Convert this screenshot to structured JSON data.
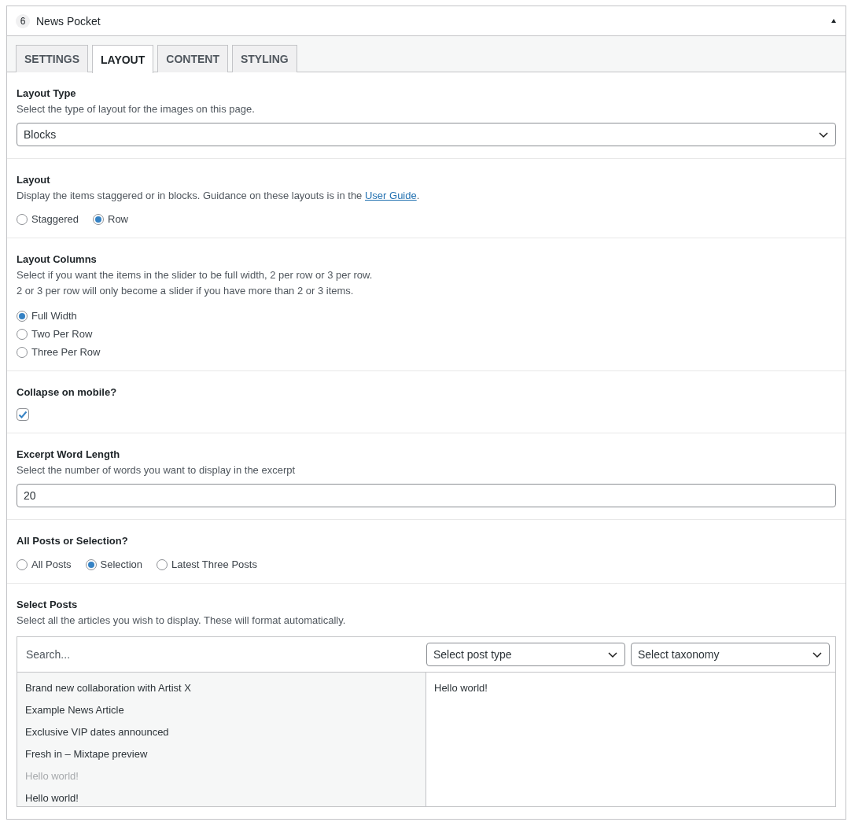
{
  "widget": {
    "number": "6",
    "title": "News Pocket",
    "expanded": true
  },
  "tabs": [
    {
      "label": "SETTINGS",
      "selected": false
    },
    {
      "label": "LAYOUT",
      "selected": true
    },
    {
      "label": "CONTENT",
      "selected": false
    },
    {
      "label": "STYLING",
      "selected": false
    }
  ],
  "fields": [
    {
      "kind": "select",
      "label": "Layout Type",
      "description": [
        "Select the type of layout for the images on this page."
      ],
      "value": "Blocks"
    },
    {
      "kind": "radio-row",
      "label": "Layout",
      "description": [
        "Display the items staggered or in blocks. Guidance on these layouts is in the "
      ],
      "link": "User Guide",
      "description_end": ".",
      "options": [
        {
          "label": "Staggered",
          "selected": false
        },
        {
          "label": "Row",
          "selected": true
        }
      ]
    },
    {
      "kind": "radio-list",
      "label": "Layout Columns",
      "description": [
        "Select if you want the items in the slider to be full width, 2 per row or 3 per row.",
        "2 or 3 per row will only become a slider if you have more than 2 or 3 items."
      ],
      "options": [
        {
          "label": "Full Width",
          "selected": true
        },
        {
          "label": "Two Per Row",
          "selected": false
        },
        {
          "label": "Three Per Row",
          "selected": false
        }
      ]
    },
    {
      "kind": "checkbox",
      "label": "Collapse on mobile?",
      "checked": true
    },
    {
      "kind": "text",
      "label": "Excerpt Word Length",
      "description": [
        "Select the number of words you want to display in the excerpt"
      ],
      "value": "20"
    },
    {
      "kind": "radio-row",
      "label": "All Posts or Selection?",
      "options": [
        {
          "label": "All Posts",
          "selected": false
        },
        {
          "label": "Selection",
          "selected": true
        },
        {
          "label": "Latest Three Posts",
          "selected": false
        }
      ]
    },
    {
      "kind": "post-selector",
      "label": "Select Posts",
      "description": [
        "Select all the articles you wish to display. These will format automatically."
      ],
      "search_placeholder": "Search...",
      "post_type": "Select post type",
      "taxonomy": "Select taxonomy",
      "available": [
        {
          "title": "Brand new collaboration with Artist X",
          "disabled": false
        },
        {
          "title": "Example News Article",
          "disabled": false
        },
        {
          "title": "Exclusive VIP dates announced",
          "disabled": false
        },
        {
          "title": "Fresh in – Mixtape preview",
          "disabled": false
        },
        {
          "title": "Hello world!",
          "disabled": true
        },
        {
          "title": "Hello world!",
          "disabled": false
        }
      ],
      "chosen": [
        "Hello world!"
      ]
    }
  ]
}
